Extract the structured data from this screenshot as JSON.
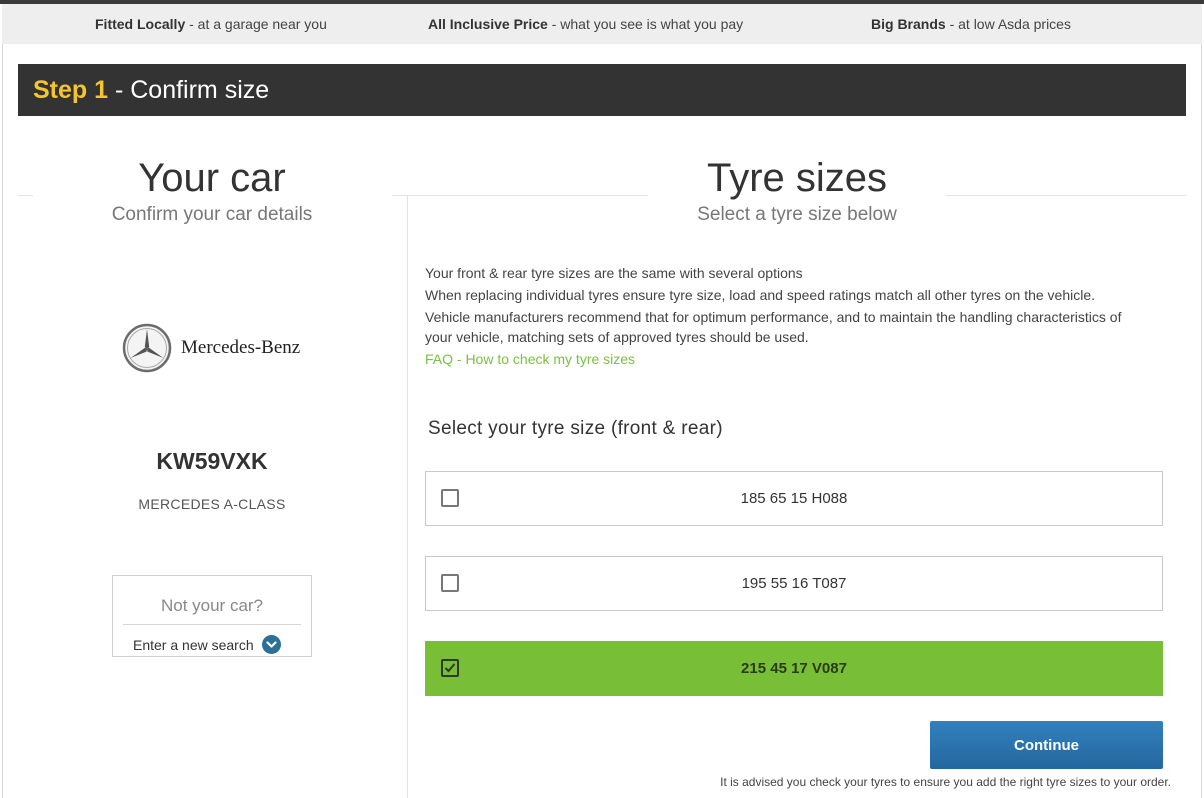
{
  "benefits": [
    {
      "title": "Fitted Locally",
      "text": " - at a garage near you"
    },
    {
      "title": "All Inclusive Price",
      "text": " - what you see is what you pay"
    },
    {
      "title": "Big Brands",
      "text": " - at low Asda prices"
    }
  ],
  "step": {
    "number": "Step 1",
    "label": " - Confirm size"
  },
  "car": {
    "title": "Your car",
    "subtitle": "Confirm your car details",
    "brand": "Mercedes-Benz",
    "registration": "KW59VXK",
    "model": "MERCEDES A-CLASS",
    "not_your_car": "Not your car?",
    "new_search": "Enter a new search"
  },
  "tyres": {
    "title": "Tyre sizes",
    "subtitle": "Select a tyre size below",
    "info_lines": [
      "Your front & rear tyre sizes are the same with several options",
      "When replacing individual tyres ensure tyre size, load and speed ratings match all other tyres on the vehicle.",
      "Vehicle manufacturers recommend that for optimum performance, and to maintain the handling characteristics of your vehicle, matching sets of approved tyres should be used."
    ],
    "faq": "FAQ - How to check my tyre sizes",
    "select_title": "Select your tyre size (front & rear)",
    "options": [
      {
        "label": "185 65 15 H088",
        "selected": false
      },
      {
        "label": "195 55 16 T087",
        "selected": false
      },
      {
        "label": "215 45 17 V087",
        "selected": true
      }
    ],
    "continue_label": "Continue",
    "advice": "It is advised you check your tyres to ensure you add the right tyre sizes to your order."
  },
  "colors": {
    "accent_yellow": "#f4c431",
    "selected_green": "#78be36",
    "link_green": "#7ac043",
    "button_blue": "#2b74b0",
    "step_bar": "#333333"
  }
}
